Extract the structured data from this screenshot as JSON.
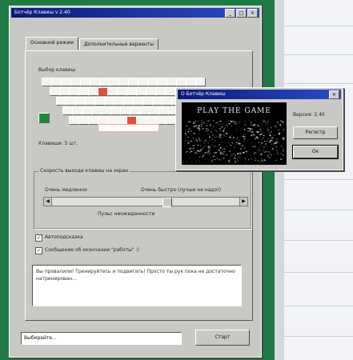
{
  "main_window": {
    "title": "Ботчёр Клавиш v 2.40",
    "tabs": [
      "Основной режим",
      "Дополнительные варианты"
    ],
    "keyboard_label": "Выбор клавиш",
    "keys_count_label": "Клавиши: 5 шт.",
    "speed_group_label": "Скорость выхода клавиш на экран",
    "slider_left_label": "Очень медленно",
    "slider_right_label": "Очень быстро (лучше не надо!)",
    "slider_caption": "Пульс неожиданности",
    "autostart_label": "Автоподсказка",
    "message_label": "Сообщение об окончании \"работы\" :)",
    "message_text": "Вы провалили! Тренируйтесь и подвигать! Просто ты рук пока не достаточно натренирован...",
    "status_text": "Выбирайте...",
    "start_button": "Старт"
  },
  "popup_window": {
    "title": "О Ботчёр Клавиш",
    "game_title": "PLAY THE GAME",
    "version_label": "Версия: 2.40",
    "buttons": [
      "Регистр",
      "Ок"
    ]
  },
  "colors": {
    "title_start": "#0a1a78",
    "title_end": "#2a4cc4",
    "key_highlight": "#e0503a",
    "key_green": "#1a8a3a",
    "window_bg": "#c8c8c4"
  }
}
